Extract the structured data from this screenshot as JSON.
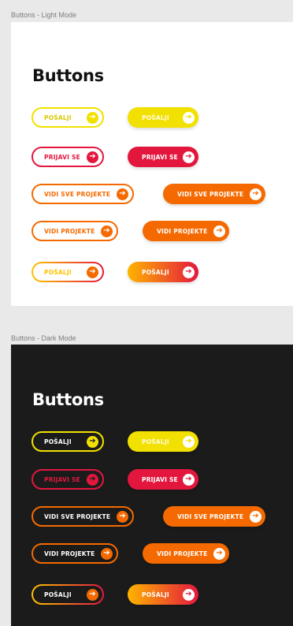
{
  "frames": {
    "light": {
      "label": "Buttons - Light Mode",
      "heading": "Buttons",
      "rows": [
        {
          "outline": {
            "label": "POŠALJI",
            "color": "#f2e100"
          },
          "filled": {
            "label": "POŠALJI",
            "color": "#f2e100"
          }
        },
        {
          "outline": {
            "label": "PRIJAVI SE",
            "color": "#e3173e"
          },
          "filled": {
            "label": "PRIJAVI SE",
            "color": "#e3173e"
          }
        },
        {
          "outline": {
            "label": "VIDI SVE PROJEKTE",
            "color": "#f56a00"
          },
          "filled": {
            "label": "VIDI SVE PROJEKTE",
            "color": "#f56a00"
          }
        },
        {
          "outline": {
            "label": "VIDI PROJEKTE",
            "color": "#f56a00"
          },
          "filled": {
            "label": "VIDI PROJEKTE",
            "color": "#f56a00"
          }
        },
        {
          "outline": {
            "label": "POŠALJI",
            "gradient": [
              "#ffc300",
              "#e3173e"
            ]
          },
          "filled": {
            "label": "POŠALJI",
            "gradient": [
              "#ffb400",
              "#e3173e"
            ]
          }
        }
      ]
    },
    "dark": {
      "label": "Buttons - Dark Mode",
      "heading": "Buttons",
      "rows": [
        {
          "outline": {
            "label": "POŠALJI",
            "color": "#f2e100"
          },
          "filled": {
            "label": "POŠALJI",
            "color": "#f2e100"
          }
        },
        {
          "outline": {
            "label": "PRIJAVI SE",
            "color": "#e3173e"
          },
          "filled": {
            "label": "PRIJAVI SE",
            "color": "#e3173e"
          }
        },
        {
          "outline": {
            "label": "VIDI SVE PROJEKTE",
            "color": "#f56a00"
          },
          "filled": {
            "label": "VIDI SVE PROJEKTE",
            "color": "#f56a00"
          }
        },
        {
          "outline": {
            "label": "VIDI PROJEKTE",
            "color": "#f56a00"
          },
          "filled": {
            "label": "VIDI PROJEKTE",
            "color": "#f56a00"
          }
        },
        {
          "outline": {
            "label": "POŠALJI",
            "gradient": [
              "#ffc300",
              "#e3173e"
            ]
          },
          "filled": {
            "label": "POŠALJI",
            "gradient": [
              "#ffb400",
              "#e3173e"
            ]
          }
        }
      ]
    }
  },
  "icon": "arrow-right-circle-icon",
  "arrow_glyph": "➔"
}
